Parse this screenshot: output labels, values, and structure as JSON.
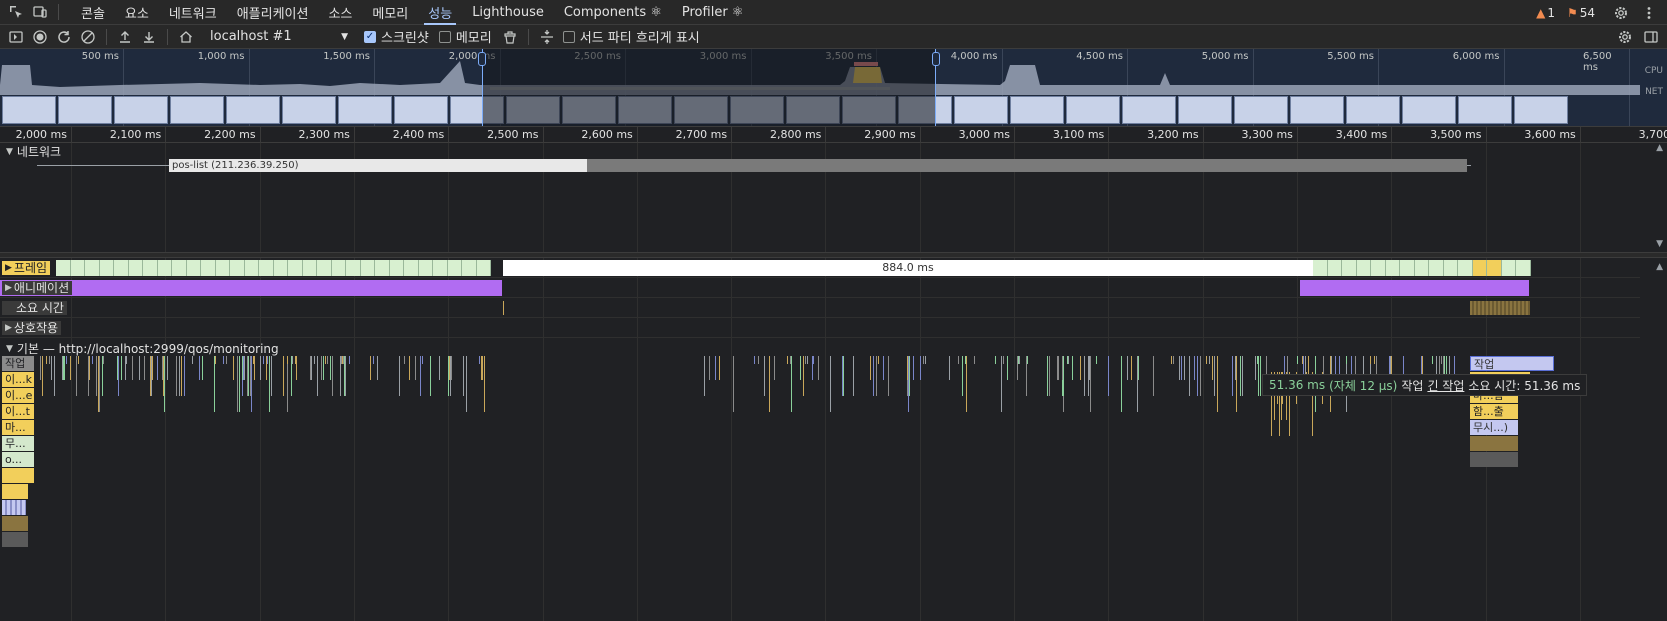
{
  "tabbar": {
    "tabs": [
      {
        "label": "콘솔"
      },
      {
        "label": "요소"
      },
      {
        "label": "네트워크"
      },
      {
        "label": "애플리케이션"
      },
      {
        "label": "소스"
      },
      {
        "label": "메모리"
      },
      {
        "label": "성능"
      },
      {
        "label": "Lighthouse"
      },
      {
        "label": "Components ⚛"
      },
      {
        "label": "Profiler ⚛"
      }
    ],
    "active_tab": "성능",
    "warnings_count": "1",
    "issues_count": "54"
  },
  "toolbar": {
    "target": "localhost #1",
    "screenshots_label": "스크린샷",
    "screenshots_checked": true,
    "memory_label": "메모리",
    "memory_checked": false,
    "third_party_label": "서드 파티 흐리게 표시",
    "third_party_checked": false
  },
  "overview": {
    "time_labels": [
      "500 ms",
      "1,000 ms",
      "1,500 ms",
      "2,000 ms",
      "2,500 ms",
      "3,000 ms",
      "3,500 ms",
      "4,000 ms",
      "4,500 ms",
      "5,000 ms",
      "5,500 ms",
      "6,000 ms",
      "6,500 ms"
    ],
    "cpu_label": "CPU",
    "net_label": "NET"
  },
  "ruler": {
    "labels": [
      "2,000 ms",
      "2,100 ms",
      "2,200 ms",
      "2,300 ms",
      "2,400 ms",
      "2,500 ms",
      "2,600 ms",
      "2,700 ms",
      "2,800 ms",
      "2,900 ms",
      "3,000 ms",
      "3,100 ms",
      "3,200 ms",
      "3,300 ms",
      "3,400 ms",
      "3,500 ms",
      "3,600 ms",
      "3,700 ms"
    ]
  },
  "network": {
    "section_label": "네트워크",
    "request_label": "pos-list (211.236.39.250)"
  },
  "tracks": {
    "frames_label": "프레임",
    "long_frame": "884.0 ms",
    "animations_label": "애니메이션",
    "timings_label": "소요 시간",
    "interactions_label": "상호작용",
    "main_label": "기본 — http://localhost:2999/qos/monitoring",
    "flame_labels": [
      "작업",
      "이...k",
      "이...e",
      "이...t",
      "마...",
      "무...",
      "o..."
    ],
    "right_flame_labels": [
      "작업",
      "마...함",
      "함...출",
      "무시...)"
    ]
  },
  "tooltip": {
    "duration": "51.36 ms",
    "self": "(자체 12 μs)",
    "task": "작업",
    "long_task": "긴 작업",
    "suffix": "소요 시간: 51.36 ms"
  },
  "colors": {
    "accent": "#a8c7fa",
    "frame_green": "#d8f0d0",
    "animation_purple": "#b16cf2",
    "scripting_yellow": "#f2cf5b",
    "warning_orange": "#f28b50"
  }
}
